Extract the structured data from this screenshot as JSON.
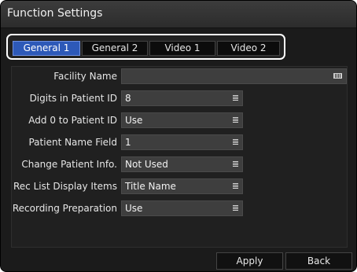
{
  "window": {
    "title": "Function Settings"
  },
  "tabs": [
    {
      "label": "General 1",
      "active": true
    },
    {
      "label": "General 2",
      "active": false
    },
    {
      "label": "Video 1",
      "active": false
    },
    {
      "label": "Video 2",
      "active": false
    }
  ],
  "settings": [
    {
      "label": "Facility Name",
      "value": "",
      "control": "keyboard-input"
    },
    {
      "label": "Digits in Patient ID",
      "value": "8",
      "control": "dropdown"
    },
    {
      "label": "Add 0 to Patient ID",
      "value": "Use",
      "control": "dropdown"
    },
    {
      "label": "Patient Name Field",
      "value": "1",
      "control": "dropdown"
    },
    {
      "label": "Change Patient Info.",
      "value": "Not Used",
      "control": "dropdown"
    },
    {
      "label": "Rec List Display Items",
      "value": "Title Name",
      "control": "dropdown"
    },
    {
      "label": "Recording Preparation",
      "value": "Use",
      "control": "dropdown"
    }
  ],
  "buttons": {
    "apply": "Apply",
    "back": "Back"
  },
  "colors": {
    "accent_tab": "#2d59b8",
    "background": "#1b1b1b",
    "field": "#3e3e3e"
  }
}
